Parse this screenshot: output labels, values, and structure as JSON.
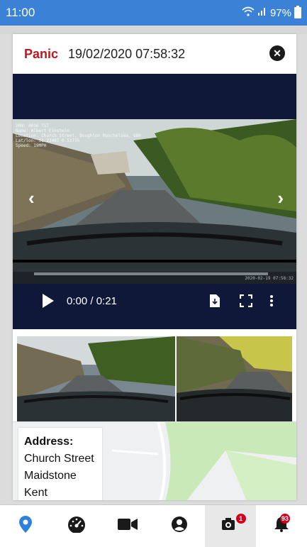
{
  "status_bar": {
    "time": "11:00",
    "battery": "97%"
  },
  "event": {
    "type": "Panic",
    "datetime": "19/02/2020 07:58:32"
  },
  "video": {
    "overlay": "VRN: AB16 TST\nName: Albert Einstein\nLocation: Church Street, Boughton Monchelsea, GBR\nLat/lon: 51.22487 0.53735\nSpeed: 19MPH",
    "timestamp": "2020-02-19 07:58:32",
    "current_time": "0:00 / 0:21"
  },
  "address": {
    "label": "Address:",
    "lines": [
      "Church Street",
      "Maidstone",
      "Kent"
    ]
  },
  "bottom_nav": {
    "items": [
      "location",
      "dashboard",
      "video",
      "profile",
      "events",
      "notifications"
    ],
    "events_badge": "1",
    "notifications_badge": "93"
  },
  "colors": {
    "status_bar": "#3b82d6",
    "panic": "#c0161c",
    "video_bg": "#0f1838",
    "accent_blue": "#2d7fe0",
    "badge": "#d0021b"
  }
}
